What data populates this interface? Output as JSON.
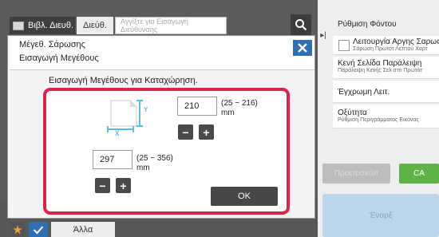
{
  "header": {
    "tab_address_book": "Βιβλ. Διευθ.",
    "tab_address": "Διεύθ.",
    "address_placeholder": "Αγγίξτε για Εισαγωγή Διεύθυνσης"
  },
  "right_panel": {
    "items": [
      {
        "title": "Ρύθμιση Φόντου",
        "subtitle": ""
      },
      {
        "title": "Λειτουργία Αργης Σαρωσης",
        "subtitle": "Σάρωση Πρωτοτ Λεπτού Χαρτ"
      },
      {
        "title": "Κενή Σελίδα Παράλειψη",
        "subtitle": "Παράλειψη Κενής Σελ στο Πρωτότ"
      },
      {
        "title": "Έγχρωμη Λειτ.",
        "subtitle": ""
      },
      {
        "title": "Οξύτητα",
        "subtitle": "Ρύθμιση Περιγράμματος Εικόνας"
      }
    ],
    "dim_button": "Προεπισκόπ",
    "ca_button": "CA",
    "start_button": "Έναρξ"
  },
  "bottom": {
    "other_button": "Άλλα"
  },
  "dialog": {
    "title_line1": "Μέγεθ. Σάρωσης",
    "title_line2": "Εισαγωγή Μεγέθους",
    "instruction": "Εισαγωγή Μεγέθους για Καταχώρηση.",
    "y_label": "Y",
    "x_label": "X",
    "y_value": "210",
    "y_range": "(25 ~ 216)\nmm",
    "x_value": "297",
    "x_range": "(25 ~ 356)\nmm",
    "minus": "−",
    "plus": "+",
    "ok_button": "OK"
  },
  "colors": {
    "highlight_frame": "#d7264c",
    "accent_blue": "#2f6fb2",
    "ca_green": "#5fb346",
    "paper_cyan": "#4fc3e8"
  }
}
